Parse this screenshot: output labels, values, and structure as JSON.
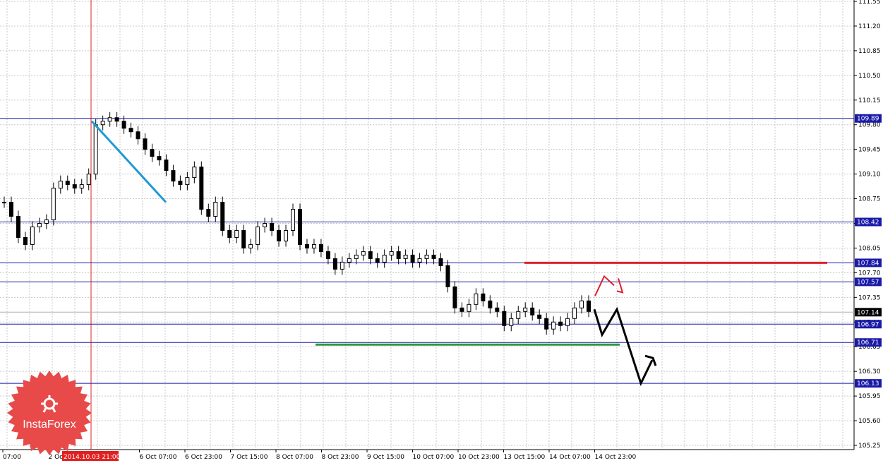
{
  "chart_data": {
    "type": "candlestick",
    "title": "",
    "grid": true,
    "colors": {
      "background": "#ffffff",
      "grid": "#c8c8c8",
      "candle": "#000000",
      "level_line": "#1a1aa8",
      "level_label_bg": "#1a1aa8",
      "current_label_bg": "#000000",
      "resistance_line": "#e0202a",
      "support_line": "#2a9a3a",
      "trend_line": "#1e9ad6",
      "forecast_main": "#000000",
      "forecast_alt": "#e0202a",
      "cursor_line": "#e02020"
    },
    "y_axis": {
      "min": 105.25,
      "max": 111.55,
      "ticks": [
        "111.55",
        "111.20",
        "110.85",
        "110.50",
        "110.15",
        "109.80",
        "109.45",
        "109.10",
        "108.75",
        "108.40",
        "108.05",
        "107.70",
        "107.35",
        "107.00",
        "106.65",
        "106.30",
        "105.95",
        "105.60",
        "105.25"
      ]
    },
    "x_axis": {
      "ticks": [
        "07:00",
        "2 Oct 23:00",
        "3 Oct 15:00",
        "6 Oct 07:00",
        "6 Oct 23:00",
        "7 Oct 15:00",
        "8 Oct 07:00",
        "8 Oct 23:00",
        "9 Oct 15:00",
        "10 Oct 07:00",
        "10 Oct 23:00",
        "13 Oct 15:00",
        "14 Oct 07:00",
        "14 Oct 23:00"
      ],
      "cursor_label": "2014.10.03 21:00"
    },
    "levels": [
      {
        "value": 109.89,
        "label": "109.89"
      },
      {
        "value": 108.42,
        "label": "108.42"
      },
      {
        "value": 107.84,
        "label": "107.84"
      },
      {
        "value": 107.57,
        "label": "107.57"
      },
      {
        "value": 106.97,
        "label": "106.97"
      },
      {
        "value": 106.71,
        "label": "106.71"
      },
      {
        "value": 106.13,
        "label": "106.13"
      }
    ],
    "current_price": {
      "value": 107.14,
      "label": "107.14"
    },
    "close_series": [
      108.7,
      108.5,
      108.2,
      108.1,
      108.35,
      108.4,
      108.45,
      108.9,
      109.0,
      108.95,
      108.9,
      108.95,
      109.1,
      109.8,
      109.85,
      109.9,
      109.85,
      109.75,
      109.7,
      109.6,
      109.45,
      109.35,
      109.3,
      109.15,
      109.0,
      108.95,
      109.05,
      109.2,
      108.6,
      108.5,
      108.7,
      108.3,
      108.2,
      108.3,
      108.05,
      108.1,
      108.35,
      108.4,
      108.3,
      108.15,
      108.3,
      108.6,
      108.1,
      108.05,
      108.1,
      108.0,
      107.9,
      107.75,
      107.85,
      107.9,
      107.95,
      108.0,
      107.9,
      107.85,
      107.95,
      108.0,
      107.9,
      107.95,
      107.85,
      107.9,
      107.95,
      107.9,
      107.8,
      107.5,
      107.2,
      107.15,
      107.25,
      107.4,
      107.3,
      107.2,
      107.15,
      106.95,
      107.05,
      107.15,
      107.2,
      107.1,
      107.05,
      106.9,
      107.0,
      106.95,
      107.05,
      107.2,
      107.3,
      107.15
    ]
  },
  "logo": {
    "text": "InstaForex"
  }
}
